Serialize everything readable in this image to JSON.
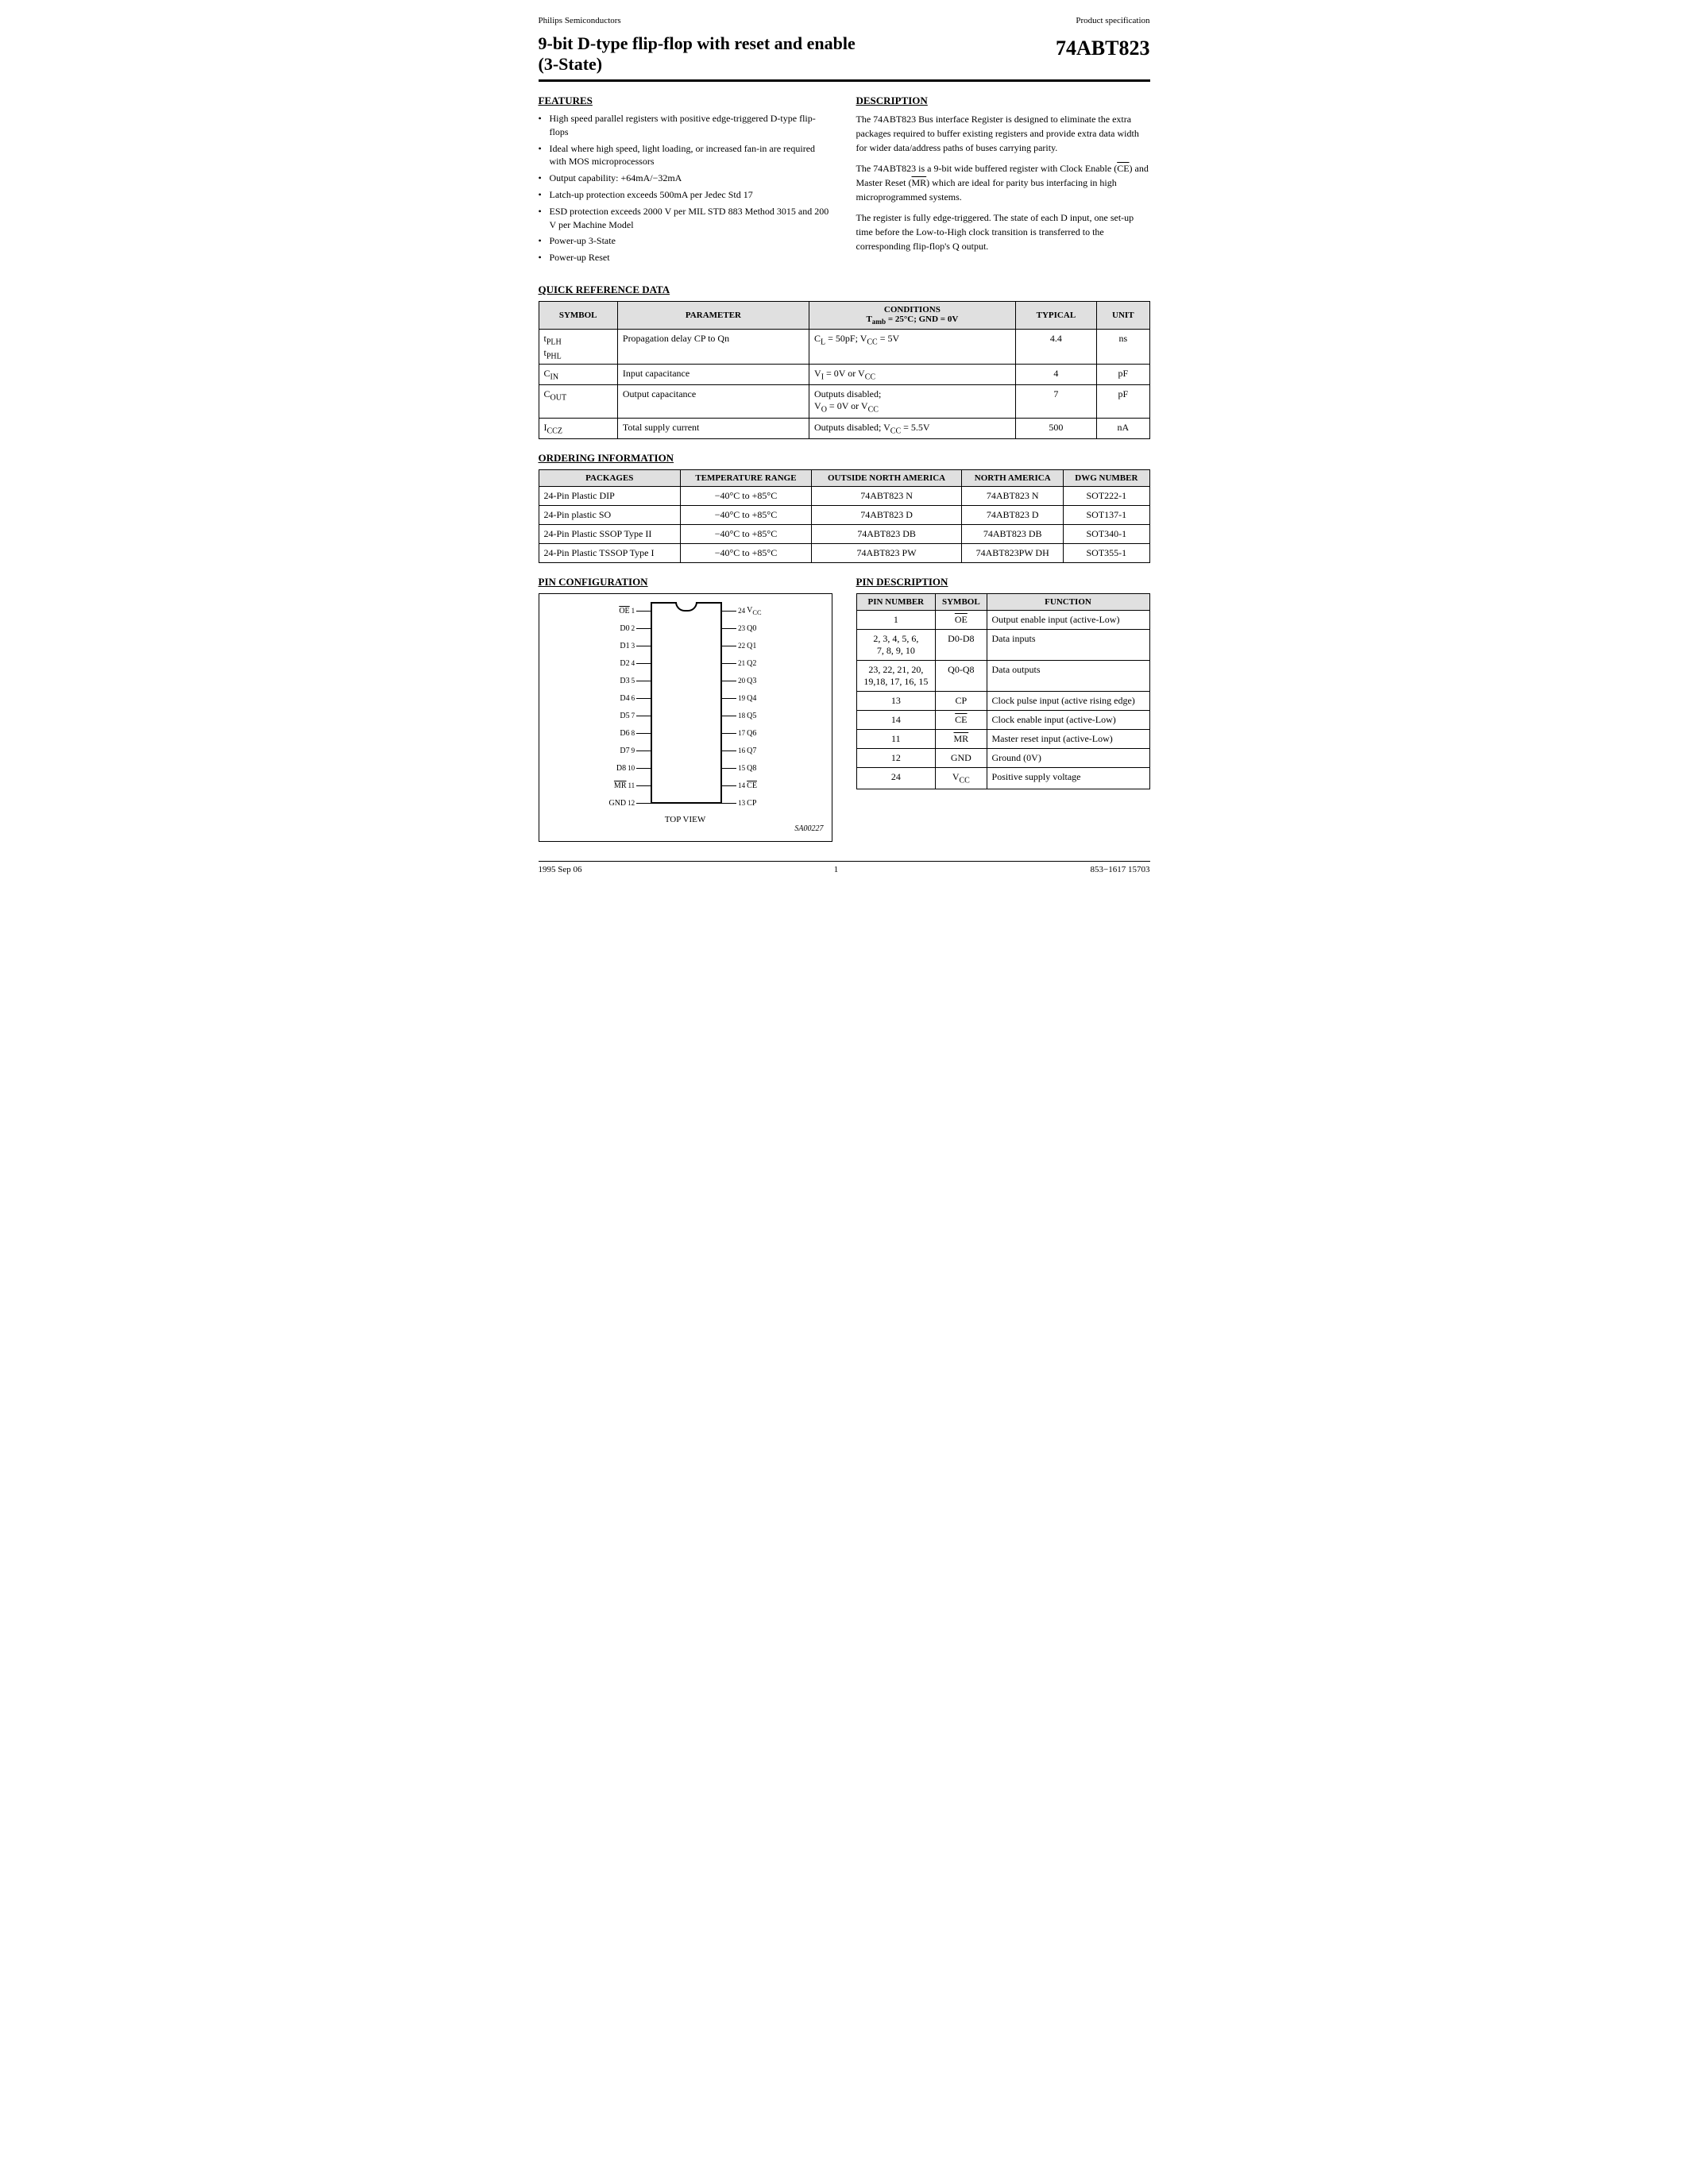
{
  "header": {
    "left": "Philips Semiconductors",
    "right": "Product specification"
  },
  "title": {
    "line1": "9-bit D-type flip-flop with reset and enable",
    "line2": "(3-State)",
    "part_number": "74ABT823"
  },
  "features": {
    "section_title": "FEATURES",
    "items": [
      "High speed parallel registers with positive edge-triggered D-type flip-flops",
      "Ideal where high speed, light loading, or increased fan-in are required with MOS microprocessors",
      "Output capability: +64mA/−32mA",
      "Latch-up protection exceeds 500mA per Jedec Std 17",
      "ESD protection exceeds 2000 V per MIL STD 883 Method 3015 and 200 V per Machine Model",
      "Power-up 3-State",
      "Power-up Reset"
    ]
  },
  "description": {
    "section_title": "DESCRIPTION",
    "paragraphs": [
      "The 74ABT823 Bus interface Register is designed to eliminate the extra packages required to buffer existing registers and provide extra data width for wider data/address paths of buses carrying parity.",
      "The 74ABT823 is a 9-bit wide buffered register with Clock Enable (CE) and Master Reset (MR) which are ideal for parity bus interfacing in high microprogrammed systems.",
      "The register is fully edge-triggered. The state of each D input, one set-up time before the Low-to-High clock transition is transferred to the corresponding flip-flop's Q output."
    ]
  },
  "quick_ref": {
    "section_title": "QUICK REFERENCE DATA",
    "columns": [
      "SYMBOL",
      "PARAMETER",
      "CONDITIONS\nTamb = 25°C; GND = 0V",
      "TYPICAL",
      "UNIT"
    ],
    "rows": [
      {
        "symbol": "tPLH / tPHL",
        "parameter": "Propagation delay CP to Qn",
        "conditions": "CL = 50pF; VCC = 5V",
        "typical": "4.4",
        "unit": "ns"
      },
      {
        "symbol": "CIN",
        "parameter": "Input capacitance",
        "conditions": "VI = 0V or VCC",
        "typical": "4",
        "unit": "pF"
      },
      {
        "symbol": "COUT",
        "parameter": "Output capacitance",
        "conditions": "Outputs disabled; VO = 0V or VCC",
        "typical": "7",
        "unit": "pF"
      },
      {
        "symbol": "ICCZ",
        "parameter": "Total supply current",
        "conditions": "Outputs disabled; VCC = 5.5V",
        "typical": "500",
        "unit": "nA"
      }
    ]
  },
  "ordering": {
    "section_title": "ORDERING INFORMATION",
    "columns": [
      "PACKAGES",
      "TEMPERATURE RANGE",
      "OUTSIDE NORTH AMERICA",
      "NORTH AMERICA",
      "DWG NUMBER"
    ],
    "rows": [
      [
        "24-Pin Plastic DIP",
        "−40°C to +85°C",
        "74ABT823 N",
        "74ABT823 N",
        "SOT222-1"
      ],
      [
        "24-Pin plastic SO",
        "−40°C to +85°C",
        "74ABT823 D",
        "74ABT823 D",
        "SOT137-1"
      ],
      [
        "24-Pin Plastic SSOP Type II",
        "−40°C to +85°C",
        "74ABT823 DB",
        "74ABT823 DB",
        "SOT340-1"
      ],
      [
        "24-Pin Plastic TSSOP Type I",
        "−40°C to +85°C",
        "74ABT823 PW",
        "74ABT823PW DH",
        "SOT355-1"
      ]
    ]
  },
  "pin_config": {
    "section_title": "PIN CONFIGURATION",
    "left_pins": [
      {
        "name": "OE",
        "num": "1",
        "overline": true
      },
      {
        "name": "D0",
        "num": "2",
        "overline": false
      },
      {
        "name": "D1",
        "num": "3",
        "overline": false
      },
      {
        "name": "D2",
        "num": "4",
        "overline": false
      },
      {
        "name": "D3",
        "num": "5",
        "overline": false
      },
      {
        "name": "D4",
        "num": "6",
        "overline": false
      },
      {
        "name": "D5",
        "num": "7",
        "overline": false
      },
      {
        "name": "D6",
        "num": "8",
        "overline": false
      },
      {
        "name": "D7",
        "num": "9",
        "overline": false
      },
      {
        "name": "D8",
        "num": "10",
        "overline": false
      },
      {
        "name": "MR",
        "num": "11",
        "overline": true
      },
      {
        "name": "GND",
        "num": "12",
        "overline": false
      }
    ],
    "right_pins": [
      {
        "name": "VCC",
        "num": "24",
        "overline": false
      },
      {
        "name": "Q0",
        "num": "23",
        "overline": false
      },
      {
        "name": "Q1",
        "num": "22",
        "overline": false
      },
      {
        "name": "Q2",
        "num": "21",
        "overline": false
      },
      {
        "name": "Q3",
        "num": "20",
        "overline": false
      },
      {
        "name": "Q4",
        "num": "19",
        "overline": false
      },
      {
        "name": "Q5",
        "num": "18",
        "overline": false
      },
      {
        "name": "Q6",
        "num": "17",
        "overline": false
      },
      {
        "name": "Q7",
        "num": "16",
        "overline": false
      },
      {
        "name": "Q8",
        "num": "15",
        "overline": false
      },
      {
        "name": "CE",
        "num": "14",
        "overline": true
      },
      {
        "name": "CP",
        "num": "13",
        "overline": false
      }
    ],
    "top_view_label": "TOP VIEW",
    "reference": "SA00227"
  },
  "pin_desc": {
    "section_title": "PIN DESCRIPTION",
    "columns": [
      "PIN NUMBER",
      "SYMBOL",
      "FUNCTION"
    ],
    "rows": [
      {
        "pin": "1",
        "symbol": "OE",
        "symbol_overline": true,
        "function": "Output enable input (active-Low)"
      },
      {
        "pin": "2, 3, 4, 5, 6, 7, 8, 9, 10",
        "symbol": "D0-D8",
        "symbol_overline": false,
        "function": "Data inputs"
      },
      {
        "pin": "23, 22, 21, 20, 19,18, 17, 16, 15",
        "symbol": "Q0-Q8",
        "symbol_overline": false,
        "function": "Data outputs"
      },
      {
        "pin": "13",
        "symbol": "CP",
        "symbol_overline": false,
        "function": "Clock pulse input (active rising edge)"
      },
      {
        "pin": "14",
        "symbol": "CE",
        "symbol_overline": true,
        "function": "Clock enable input (active-Low)"
      },
      {
        "pin": "11",
        "symbol": "MR",
        "symbol_overline": true,
        "function": "Master reset input (active-Low)"
      },
      {
        "pin": "12",
        "symbol": "GND",
        "symbol_overline": false,
        "function": "Ground (0V)"
      },
      {
        "pin": "24",
        "symbol": "VCC",
        "symbol_overline": false,
        "function": "Positive supply voltage"
      }
    ]
  },
  "footer": {
    "left": "1995 Sep 06",
    "center": "1",
    "right": "853−1617 15703"
  }
}
